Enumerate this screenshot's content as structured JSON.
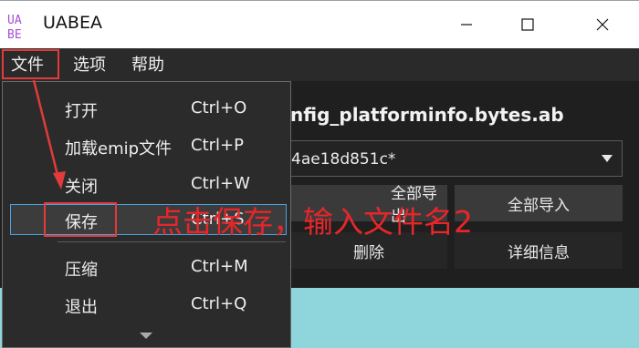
{
  "window": {
    "title": "UABEA",
    "logo_text": [
      "UA",
      "BE"
    ],
    "controls": {
      "minimize": "minimize-icon",
      "maximize": "maximize-icon",
      "close": "close-icon"
    }
  },
  "menubar": {
    "items": [
      {
        "label": "文件"
      },
      {
        "label": "选项"
      },
      {
        "label": "帮助"
      }
    ]
  },
  "file_menu": {
    "items": [
      {
        "label": "打开",
        "shortcut": "Ctrl+O"
      },
      {
        "label": "加载emip文件",
        "shortcut": "Ctrl+P"
      },
      {
        "label": "关闭",
        "shortcut": "Ctrl+W"
      },
      {
        "label": "保存",
        "shortcut": "Ctrl+S",
        "highlighted": true
      },
      {
        "label": "压缩",
        "shortcut": "Ctrl+M"
      },
      {
        "label": "退出",
        "shortcut": "Ctrl+Q"
      }
    ],
    "more_indicator": "chevron-down-icon"
  },
  "main": {
    "filename": "nfig_platforminfo.bytes.ab",
    "bundle_select_value": "4ae18d851c*",
    "buttons": {
      "export_all": "全部导出",
      "import_all": "全部导入",
      "remove": "删除",
      "info": "详细信息"
    }
  },
  "annotation": {
    "text": "点击保存，输入文件名2",
    "color": "#e8262a"
  },
  "colors": {
    "accent_highlight": "#4aa3df",
    "annotation_red": "#e23b3b",
    "dark_bg": "#1f1f1f"
  }
}
